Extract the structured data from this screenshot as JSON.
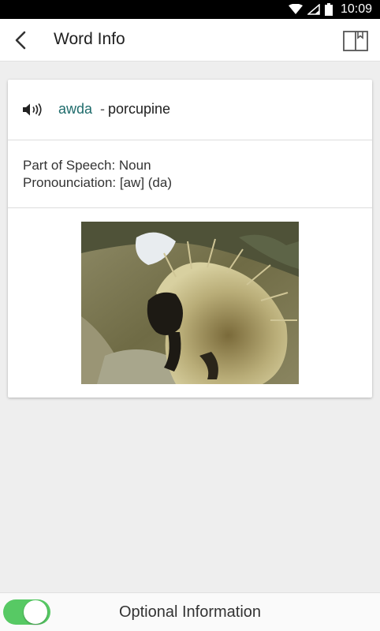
{
  "status_bar": {
    "time": "10:09"
  },
  "app_bar": {
    "title": "Word Info"
  },
  "entry": {
    "word": "awda",
    "separator": "-",
    "translation": "porcupine",
    "part_of_speech": "Part of Speech: Noun",
    "pronunciation": "Pronounciation: [aw] (da)"
  },
  "image": {
    "icon": "porcupine-photo"
  },
  "footer": {
    "toggle_on": true,
    "label": "Optional Information"
  },
  "colors": {
    "accent_teal": "#1e6b6b",
    "toggle_green": "#57c964"
  }
}
